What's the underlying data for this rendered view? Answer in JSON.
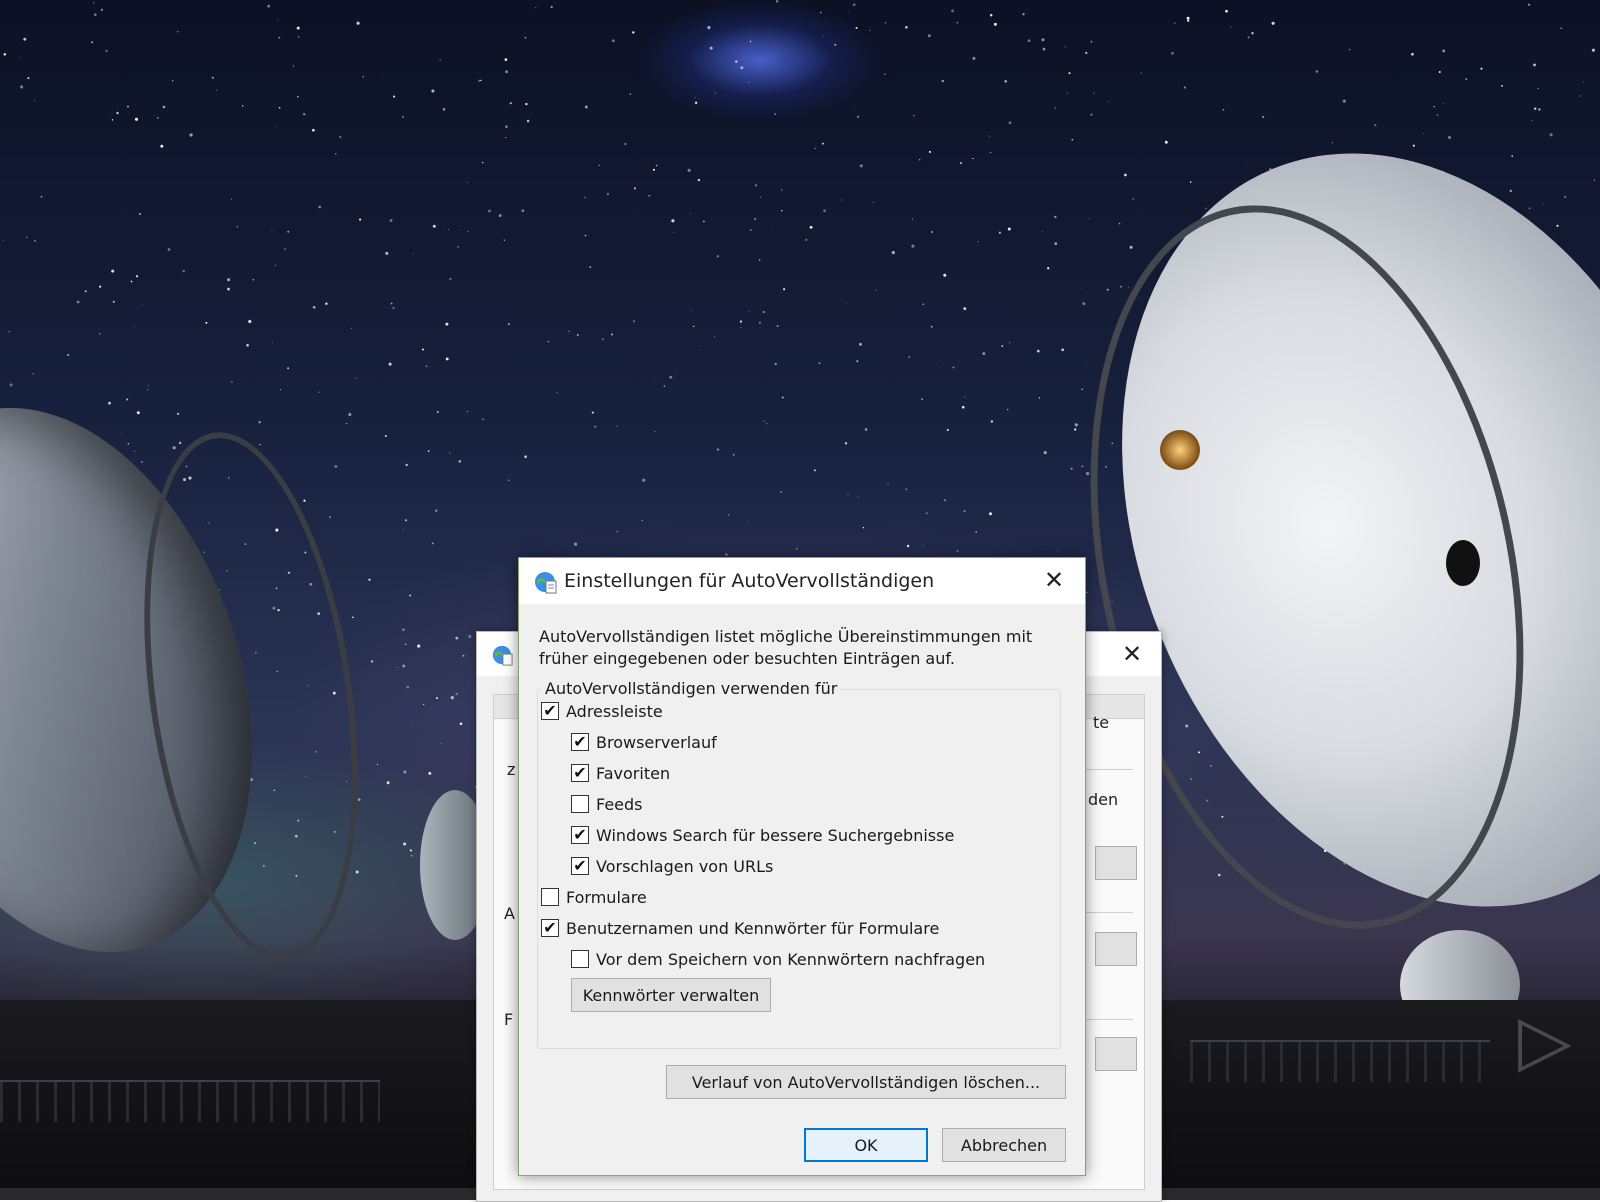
{
  "dialog": {
    "title": "Einstellungen für AutoVervollständigen",
    "close_glyph": "✕",
    "description": "AutoVervollständigen listet mögliche Übereinstimmungen mit früher eingegebenen oder besuchten Einträgen auf.",
    "group_label": "AutoVervollständigen verwenden für",
    "checkboxes": [
      {
        "label": "Adressleiste",
        "checked": true,
        "glyph": "✔"
      },
      {
        "label": "Browserverlauf",
        "checked": true,
        "glyph": "✔"
      },
      {
        "label": "Favoriten",
        "checked": true,
        "glyph": "✔"
      },
      {
        "label": "Feeds",
        "checked": false,
        "glyph": ""
      },
      {
        "label": "Windows Search für bessere Suchergebnisse",
        "checked": true,
        "glyph": "✔"
      },
      {
        "label": "Vorschlagen von URLs",
        "checked": true,
        "glyph": "✔"
      },
      {
        "label": "Formulare",
        "checked": false,
        "glyph": ""
      },
      {
        "label": "Benutzernamen und Kennwörter für Formulare",
        "checked": true,
        "glyph": "✔"
      },
      {
        "label": "Vor dem Speichern von Kennwörtern nachfragen",
        "checked": false,
        "glyph": ""
      }
    ],
    "manage_passwords_button": "Kennwörter verwalten",
    "delete_history_button": "Verlauf von AutoVervollständigen löschen...",
    "ok_button": "OK",
    "cancel_button": "Abbrechen"
  },
  "background_window": {
    "close_glyph": "✕",
    "fragments": [
      "te",
      "den",
      "z",
      "A",
      "F"
    ]
  },
  "colors": {
    "dialog_bg": "#f0f0f0",
    "dialog_border": "#89a36a",
    "default_button_accent": "#0078d7"
  },
  "icons": {
    "dialog_title_icon": "internet-options-globe-icon",
    "bg_window_icon": "internet-options-globe-icon",
    "checkmark": "checkmark-icon",
    "wallpaper_watermark": "bing-logo-icon"
  }
}
